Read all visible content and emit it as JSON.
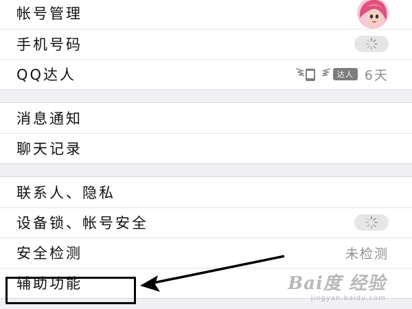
{
  "account_group": {
    "items": [
      {
        "label": "帐号管理",
        "right": "avatar"
      },
      {
        "label": "手机号码",
        "right": "spinner"
      },
      {
        "label": "QQ达人",
        "badge_text": "达人",
        "value": "6天"
      }
    ]
  },
  "notification_group": {
    "items": [
      {
        "label": "消息通知"
      },
      {
        "label": "聊天记录"
      }
    ]
  },
  "privacy_group": {
    "items": [
      {
        "label": "联系人、隐私"
      },
      {
        "label": "设备锁、帐号安全",
        "right": "spinner"
      },
      {
        "label": "安全检测",
        "value": "未检测"
      },
      {
        "label": "辅助功能"
      }
    ]
  },
  "watermark": {
    "brand": "Bai度 经验",
    "url": "jingyan.baidu.com"
  },
  "colors": {
    "background": "#efeff4",
    "row_background": "#ffffff",
    "label_text": "#111111",
    "value_text": "#8e8e8e",
    "annotation": "#000000"
  },
  "icons": {
    "avatar": "avatar-cartoon-girl",
    "spinner": "loading-spinner-icon",
    "badge": "qq-daren-phone-wings-icon"
  }
}
